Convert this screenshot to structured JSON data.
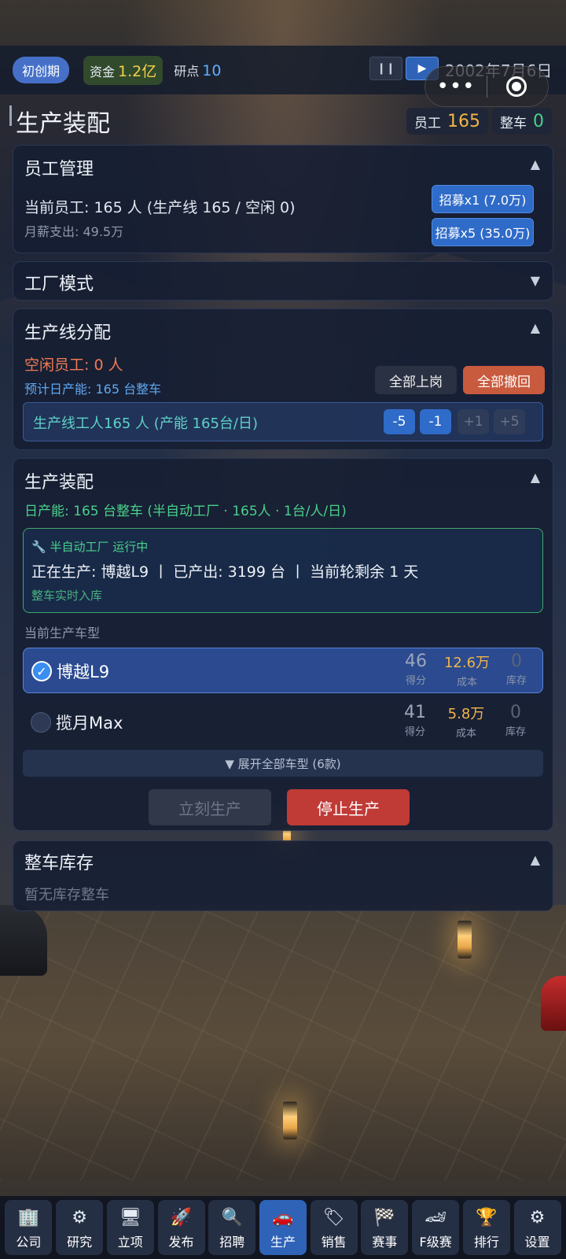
{
  "topbar": {
    "stage": "初创期",
    "fund_label": "资金",
    "fund_value": "1.2亿",
    "research_label": "研点",
    "research_value": "10",
    "pause_icon": "pause-icon",
    "play_icon": "play-icon",
    "date": "2002年7月6日",
    "menu_dots": "•••"
  },
  "header": {
    "title": "生产装配",
    "employee_label": "员工",
    "employee_value": "165",
    "car_label": "整车",
    "car_value": "0"
  },
  "staff": {
    "title": "员工管理",
    "current": "当前员工: 165 人 (生产线 165 / 空闲 0)",
    "salary": "月薪支出: 49.5万",
    "hire1": "招募x1 (7.0万)",
    "hire5": "招募x5 (35.0万)"
  },
  "factory_mode": {
    "title": "工厂模式"
  },
  "line_alloc": {
    "title": "生产线分配",
    "idle": "空闲员工: 0 人",
    "forecast": "预计日产能: 165 台整车",
    "all_on": "全部上岗",
    "all_off": "全部撤回",
    "line_workers": "生产线工人165 人 (产能 165台/日)",
    "minus5": "-5",
    "minus1": "-1",
    "plus1": "+1",
    "plus5": "+5"
  },
  "assembly": {
    "title": "生产装配",
    "daily": "日产能: 165 台整车 (半自动工厂 · 165人 · 1台/人/日)",
    "status_title": "半自动工厂 运行中",
    "status_line": "正在生产: 博越L9 丨 已产出: 3199 台 丨 当前轮剩余 1 天",
    "status_sub": "整车实时入库",
    "current_model_label": "当前生产车型",
    "models": [
      {
        "name": "博越L9",
        "score": "46",
        "cost": "12.6万",
        "stock": "0",
        "selected": true
      },
      {
        "name": "揽月Max",
        "score": "41",
        "cost": "5.8万",
        "stock": "0",
        "selected": false
      }
    ],
    "score_label": "得分",
    "cost_label": "成本",
    "stock_label": "库存",
    "expand": "▼ 展开全部车型 (6款)",
    "produce_now": "立刻生产",
    "stop": "停止生产"
  },
  "inventory": {
    "title": "整车库存",
    "empty": "暂无库存整车"
  },
  "nav": [
    {
      "label": "公司",
      "icon": "🏢"
    },
    {
      "label": "研究",
      "icon": "⚙"
    },
    {
      "label": "立项",
      "icon": "🖥"
    },
    {
      "label": "发布",
      "icon": "🚀"
    },
    {
      "label": "招聘",
      "icon": "🔍"
    },
    {
      "label": "生产",
      "icon": "🚗"
    },
    {
      "label": "销售",
      "icon": "🏷"
    },
    {
      "label": "赛事",
      "icon": "🏁"
    },
    {
      "label": "F级赛",
      "icon": "🏎"
    },
    {
      "label": "排行",
      "icon": "🏆"
    },
    {
      "label": "设置",
      "icon": "⚙"
    }
  ]
}
